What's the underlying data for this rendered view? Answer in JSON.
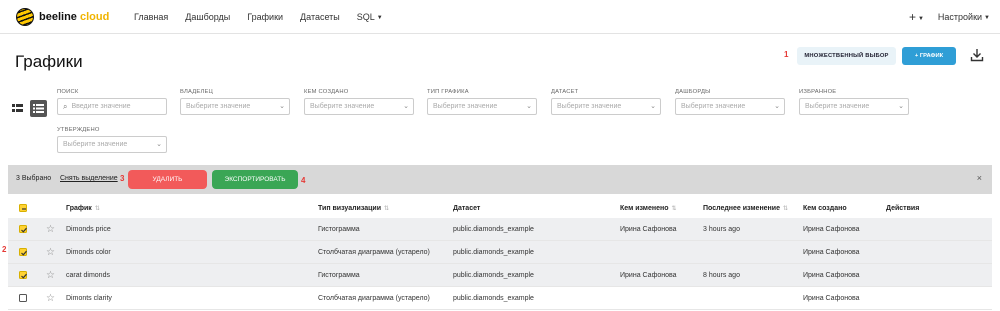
{
  "header": {
    "logo_text": "beeline",
    "logo_text_accent": "cloud",
    "nav": [
      "Главная",
      "Дашборды",
      "Графики",
      "Датасеты",
      "SQL"
    ],
    "plus_label": "+",
    "settings_label": "Настройки"
  },
  "page": {
    "title": "Графики",
    "multi_select_label": "МНОЖЕСТВЕННЫЙ ВЫБОР",
    "add_chart_label": "+ ГРАФИК"
  },
  "annotations": {
    "n1": "1",
    "n2": "2",
    "n3": "3",
    "n4": "4"
  },
  "filters": {
    "search": {
      "label": "ПОИСК",
      "placeholder": "Введите значение"
    },
    "owner": {
      "label": "ВЛАДЕЛЕЦ",
      "placeholder": "Выберите значение"
    },
    "created_by": {
      "label": "КЕМ СОЗДАНО",
      "placeholder": "Выберите значение"
    },
    "chart_type": {
      "label": "ТИП ГРАФИКА",
      "placeholder": "Выберите значение"
    },
    "dataset": {
      "label": "ДАТАСЕТ",
      "placeholder": "Выберите значение"
    },
    "dashboards": {
      "label": "ДАШБОРДЫ",
      "placeholder": "Выберите значение"
    },
    "favorite": {
      "label": "ИЗБРАННОЕ",
      "placeholder": "Выберите значение"
    },
    "approved": {
      "label": "УТВЕРЖДЕНО",
      "placeholder": "Выберите значение"
    }
  },
  "selection_bar": {
    "count": "3 Выбрано",
    "clear": "Снять выделение",
    "delete": "УДАЛИТЬ",
    "export": "ЭКСПОРТИРОВАТЬ",
    "close": "×"
  },
  "table": {
    "columns": {
      "chart": "График",
      "viz_type": "Тип визуализации",
      "dataset": "Датасет",
      "modified_by": "Кем изменено",
      "last_modified": "Последнее изменение",
      "created_by": "Кем создано",
      "actions": "Действия"
    },
    "rows": [
      {
        "name": "Dimonds price",
        "viz": "Гистограмма",
        "dataset": "public.diamonds_example",
        "modified_by": "Ирина Сафонова",
        "modified": "3 hours ago",
        "created_by": "Ирина Сафонова",
        "checked": true
      },
      {
        "name": "Dimonds color",
        "viz": "Столбчатая диаграмма (устарело)",
        "dataset": "public.diamonds_example",
        "modified_by": "",
        "modified": "",
        "created_by": "Ирина Сафонова",
        "checked": true
      },
      {
        "name": "carat dimonds",
        "viz": "Гистограмма",
        "dataset": "public.diamonds_example",
        "modified_by": "Ирина Сафонова",
        "modified": "8 hours ago",
        "created_by": "Ирина Сафонова",
        "checked": true
      },
      {
        "name": "Dimonts clarity",
        "viz": "Столбчатая диаграмма (устарело)",
        "dataset": "public.diamonds_example",
        "modified_by": "",
        "modified": "",
        "created_by": "Ирина Сафонова",
        "checked": false
      }
    ]
  }
}
